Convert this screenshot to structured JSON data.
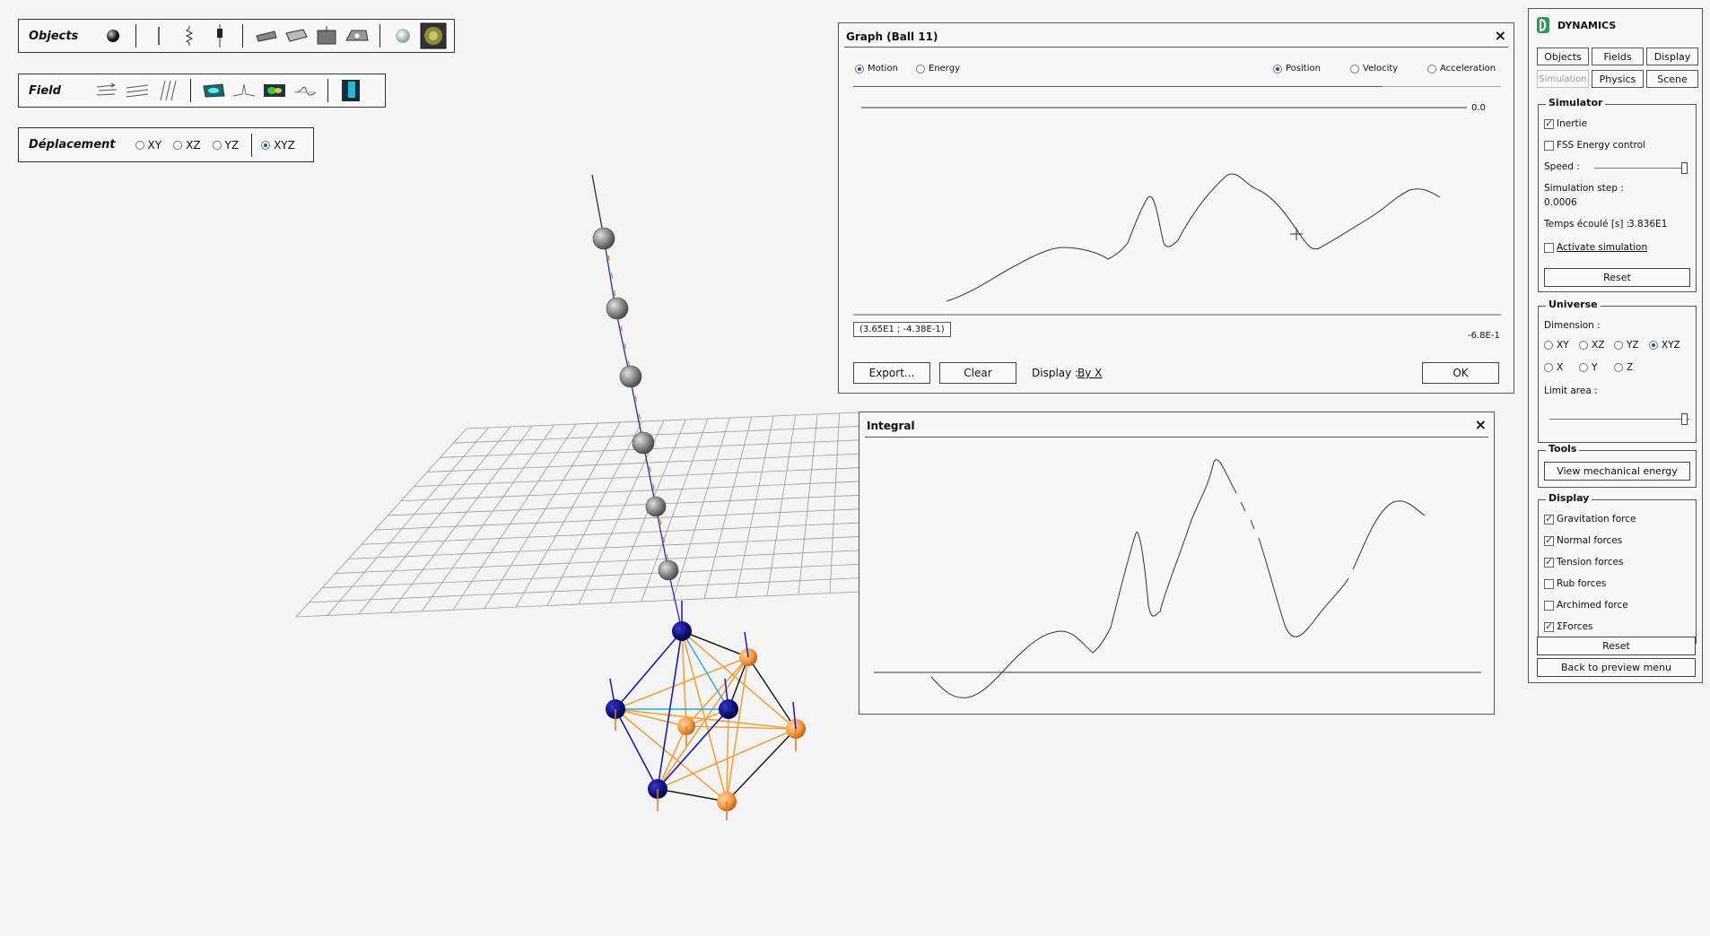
{
  "toolbars": {
    "objects": {
      "title": "Objects"
    },
    "field": {
      "title": "Field"
    },
    "deplacement": {
      "title": "Déplacement",
      "options": [
        "XY",
        "XZ",
        "YZ",
        "XYZ"
      ],
      "selected": "XYZ"
    }
  },
  "graph_window": {
    "title": "Graph (Ball 11)",
    "modes": [
      "Motion",
      "Energy"
    ],
    "mode_selected": "Motion",
    "quantities": [
      "Position",
      "Velocity",
      "Acceleration"
    ],
    "quantity_selected": "Position",
    "y_top_label": "0.0",
    "y_bottom_label": "-6.8E-1",
    "tooltip": "(3.65E1 ; -4.38E-1)",
    "export_label": "Export...",
    "clear_label": "Clear",
    "display_label": "Display :",
    "display_value": "By X",
    "ok_label": "OK"
  },
  "integral_window": {
    "title": "Integral"
  },
  "panel": {
    "app_name": "DYNAMICS",
    "tabs": [
      "Objects",
      "Fields",
      "Display",
      "Simulation",
      "Physics",
      "Scene"
    ],
    "simulator": {
      "title": "Simulator",
      "inertie": "Inertie",
      "fss": "FSS Energy control",
      "speed": "Speed :",
      "step_label": "Simulation step :",
      "step_value": "0.0006",
      "temps_label": "Temps écoulé [s] :",
      "temps_value": "3.836E1",
      "activate": "Activate simulation",
      "reset": "Reset"
    },
    "universe": {
      "title": "Universe",
      "dimension": "Dimension :",
      "dims_row1": [
        "XY",
        "XZ",
        "YZ",
        "XYZ"
      ],
      "dims_row2": [
        "X",
        "Y",
        "Z"
      ],
      "selected": "XYZ",
      "limit_area": "Limit area :"
    },
    "tools": {
      "title": "Tools",
      "view_energy": "View mechanical energy"
    },
    "display": {
      "title": "Display",
      "items": [
        {
          "label": "Gravitation force",
          "checked": true
        },
        {
          "label": "Normal forces",
          "checked": true
        },
        {
          "label": "Tension forces",
          "checked": true
        },
        {
          "label": "Rub forces",
          "checked": false
        },
        {
          "label": "Archimed force",
          "checked": false
        },
        {
          "label": "ΣForces",
          "checked": true
        }
      ],
      "reset": "Reset",
      "back": "Back to preview menu"
    }
  }
}
